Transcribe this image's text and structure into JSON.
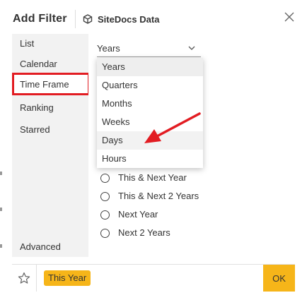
{
  "header": {
    "title": "Add Filter",
    "datasource_icon": "cube-icon",
    "datasource_name": "SiteDocs Data",
    "close_icon": "close-icon"
  },
  "sidebar": {
    "items": [
      {
        "label": "List"
      },
      {
        "label": "Calendar"
      },
      {
        "label": "Time Frame",
        "active": true
      },
      {
        "label": "Ranking"
      },
      {
        "label": "Starred"
      }
    ],
    "advanced_label": "Advanced"
  },
  "main": {
    "select": {
      "value": "Years",
      "icon": "chevron-down-icon"
    },
    "dropdown": {
      "options": [
        "Years",
        "Quarters",
        "Months",
        "Weeks",
        "Days",
        "Hours"
      ],
      "selected": "Years",
      "highlighted": "Days"
    },
    "radios": [
      {
        "label": "This & Next Year"
      },
      {
        "label": "This & Next 2 Years"
      },
      {
        "label": "Next Year"
      },
      {
        "label": "Next 2 Years"
      }
    ]
  },
  "annotation": {
    "highlight_color": "#e21c22",
    "arrow_color": "#e21c22"
  },
  "footer": {
    "star_icon": "star-icon",
    "chip_label": "This Year",
    "ok_label": "OK",
    "accent_color": "#f6b519"
  }
}
